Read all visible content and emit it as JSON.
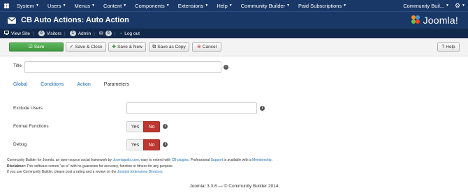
{
  "topbar": {
    "menu": [
      "System",
      "Users",
      "Menus",
      "Content",
      "Components",
      "Extensions",
      "Help",
      "Community Builder",
      "Paid Subscriptions"
    ],
    "user_menu": "Community Buil..."
  },
  "titlebar": {
    "title": "CB Auto Actions: Auto Action",
    "brand": "Joomla!"
  },
  "statusbar": {
    "view_site": "View Site",
    "visitors_count": "0",
    "visitors_label": "Visitors",
    "admin_count": "1",
    "admin_label": "Admin",
    "messages_count": "0",
    "logout": "Log out"
  },
  "toolbar": {
    "save": "Save",
    "save_close": "Save & Close",
    "save_new": "Save & New",
    "save_copy": "Save as Copy",
    "cancel": "Cancel",
    "help": "Help"
  },
  "form": {
    "title_label": "Title",
    "title_value": "",
    "tabs": [
      "Global",
      "Conditions",
      "Action",
      "Parameters"
    ],
    "active_tab": "Parameters",
    "exclude_users_label": "Exclude Users",
    "exclude_users_value": "",
    "format_functions_label": "Format Functions",
    "debug_label": "Debug",
    "yes": "Yes",
    "no": "No"
  },
  "footer": {
    "line1_a": "Community Builder for Joomla, an open-source social framework by",
    "line1_link1": "Joomlapolis.com",
    "line1_b": ", easy to extend with",
    "line1_link2": "CB plugins",
    "line1_c": ". Professional",
    "line1_link3": "Support",
    "line1_d": "is available with a",
    "line1_link4": "Membership",
    "line1_e": ".",
    "disclaimer_label": "Disclaimer:",
    "disclaimer_text": "This software comes \"as is\" with no guarantee for accuracy, function or fitness for any purpose.",
    "line3_a": "If you use Community Builder, please post a rating and a review on the",
    "line3_link": "Joomla! Extensions Directory",
    "line3_b": ".",
    "copyright": "Joomla! 3.3.6  —  © Community Builder 2014"
  },
  "colors": {
    "nav_bg": "#1a3867",
    "save_green": "#5cb85c",
    "no_red": "#bd362f",
    "link_blue": "#1f72b8"
  },
  "icons": [
    "joomla-icon",
    "caret-down-icon",
    "gear-icon",
    "envelope-icon",
    "joomla-logo-icon",
    "view-site-icon",
    "check-icon",
    "plus-icon",
    "copy-icon",
    "cancel-icon",
    "help-icon",
    "info-icon"
  ]
}
